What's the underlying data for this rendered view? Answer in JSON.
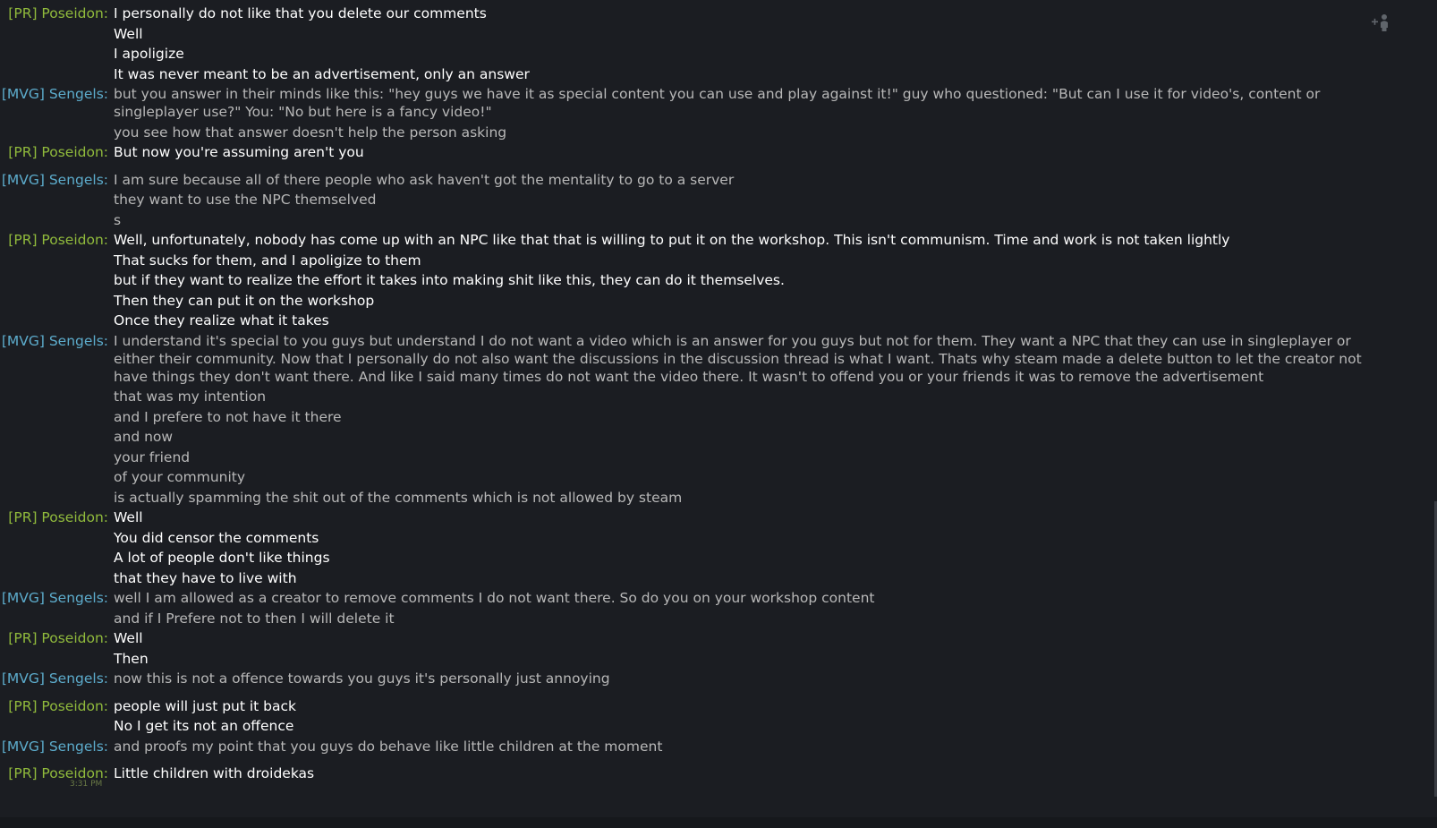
{
  "messages": [
    {
      "sender": "[PR] Poseidon:",
      "self": true,
      "gap": false,
      "lines": [
        "I personally do not like that you delete our comments",
        "Well",
        "I apoligize",
        "It was never meant to be an advertisement, only an answer"
      ]
    },
    {
      "sender": "[MVG] Sengels:",
      "self": false,
      "gap": false,
      "lines": [
        "but you answer in their minds like this: \"hey guys we have it as special content you can use and play against it!\" guy who questioned: \"But can I use it for video's, content or singleplayer use?\" You: \"No but here is a fancy video!\"",
        "you see how that answer doesn't help the person asking"
      ]
    },
    {
      "sender": "[PR] Poseidon:",
      "self": true,
      "gap": false,
      "lines": [
        "But now you're assuming aren't you"
      ]
    },
    {
      "sender": "[MVG] Sengels:",
      "self": false,
      "gap": true,
      "lines": [
        "I am sure because all of there people who ask haven't got the mentality to go to a server",
        "they want to use the NPC themselved",
        "s"
      ]
    },
    {
      "sender": "[PR] Poseidon:",
      "self": true,
      "gap": false,
      "lines": [
        "Well, unfortunately, nobody has come up with an NPC like that that is willing to put it on the workshop. This isn't communism. Time and work is not taken lightly",
        "That sucks for them, and I apoligize to them",
        "but if they want to realize the effort it takes into making shit like this, they can do it themselves.",
        "Then they can put it on the workshop",
        "Once they realize what it takes"
      ]
    },
    {
      "sender": "[MVG] Sengels:",
      "self": false,
      "gap": false,
      "lines": [
        "I understand it's special to you guys but understand I do not want a video which is an answer for you guys but not for them. They want a NPC that they can use in singleplayer or either their community. Now that I personally do not also want the discussions in the discussion thread is what I want. Thats why steam made a delete button to let the creator not have things they don't want there. And like I said many times do not want the video there. It wasn't to offend you or your friends it was to remove the advertisement",
        "that was my intention",
        "and I prefere to not have it there",
        "and now",
        "your friend",
        "of your community",
        "is actually spamming the shit out of the comments which is not allowed by steam"
      ]
    },
    {
      "sender": "[PR] Poseidon:",
      "self": true,
      "gap": false,
      "lines": [
        "Well",
        "You did censor the comments",
        "A lot of people don't like things",
        "that they have to live with"
      ]
    },
    {
      "sender": "[MVG] Sengels:",
      "self": false,
      "gap": false,
      "lines": [
        "well I am allowed as a creator to remove comments I do not want there. So do you on your workshop content",
        "and if I Prefere not to then I will delete it"
      ]
    },
    {
      "sender": "[PR] Poseidon:",
      "self": true,
      "gap": false,
      "lines": [
        "Well",
        "Then"
      ]
    },
    {
      "sender": "[MVG] Sengels:",
      "self": false,
      "gap": false,
      "lines": [
        "now this is not a offence towards you guys it's personally just annoying"
      ]
    },
    {
      "sender": "[PR] Poseidon:",
      "self": true,
      "gap": true,
      "lines": [
        "people will just put it back",
        "No I get its not an offence"
      ]
    },
    {
      "sender": "[MVG] Sengels:",
      "self": false,
      "gap": false,
      "lines": [
        "and proofs my point that you guys do behave like little children at the moment"
      ]
    },
    {
      "sender": "[PR] Poseidon:",
      "self": true,
      "gap": true,
      "lines": [
        "Little children with droidekas"
      ]
    }
  ],
  "last_timestamp": "3:31 PM",
  "colors": {
    "background": "#1b1d22",
    "self_name": "#90ba3c",
    "other_name": "#6dcff6",
    "self_text": "#ffffff",
    "other_text": "#b8b8b8"
  },
  "icons": {
    "add_friend": "add-friend-icon"
  }
}
